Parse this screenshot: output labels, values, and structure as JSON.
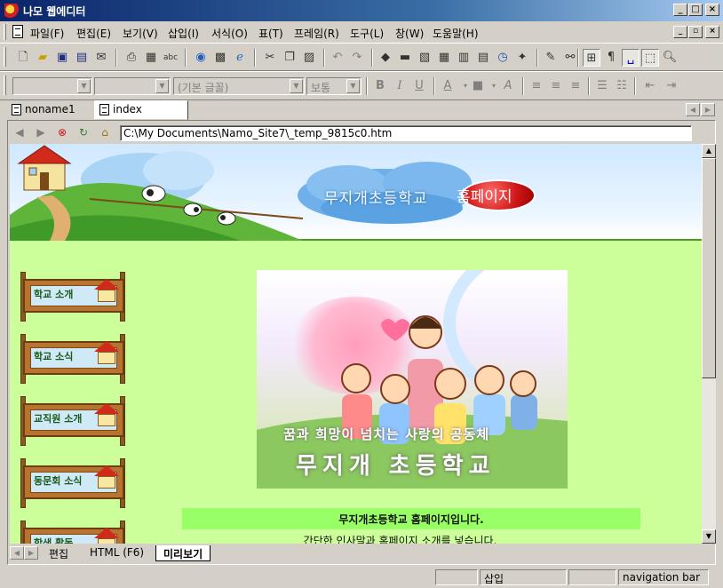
{
  "window": {
    "title": "나모 웹에디터",
    "min_glyph": "_",
    "max_glyph": "□",
    "close_glyph": "×"
  },
  "menu": {
    "items": [
      "파일(F)",
      "편집(E)",
      "보기(V)",
      "삽입(I)",
      "서식(O)",
      "표(T)",
      "프레임(R)",
      "도구(L)",
      "창(W)",
      "도움말(H)"
    ],
    "mdi_min": "_",
    "mdi_restore": "▫",
    "mdi_close": "×"
  },
  "toolbar_format": {
    "style_combo": "",
    "font_combo": "",
    "default_font": "(기본 글꼴)",
    "size_combo": "보통"
  },
  "tabs": [
    {
      "label": "noname1",
      "active": false
    },
    {
      "label": "index",
      "active": true
    }
  ],
  "address": {
    "value": "C:\\My Documents\\Namo_Site7\\_temp_9815c0.htm"
  },
  "page": {
    "site_title_left": "무지개초등학교",
    "site_title_right": "홈페이지",
    "nav": [
      "학교 소개",
      "학교 소식",
      "교직원 소개",
      "동문회 소식",
      "학생 활동"
    ],
    "photo_caption_1": "꿈과 희망이 넘치는 사랑의 공동체",
    "photo_caption_2": "무지개 초등학교",
    "welcome": "무지개초등학교  홈페이지입니다.",
    "intro": "간단한 인사말과 홈페이지 소개를 넣습니다."
  },
  "view_tabs": [
    {
      "label": "편집",
      "active": false
    },
    {
      "label": "HTML (F6)",
      "active": false
    },
    {
      "label": "미리보기",
      "active": true
    }
  ],
  "status": {
    "panel1": "",
    "insert_mode": "삽입",
    "panel3": "",
    "panel4": "",
    "tag_path": "navigation bar"
  },
  "colors": {
    "page_bg": "#ccff99",
    "welcome_bar": "#99ff66",
    "title_gradient_start": "#0a246a",
    "title_badge": "#d01818"
  }
}
